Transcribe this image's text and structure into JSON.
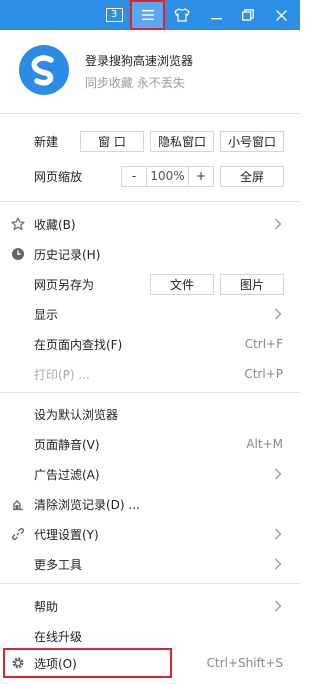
{
  "titlebar": {
    "tab_count": "3",
    "bg_color": "#2d8ee6",
    "icons": [
      "tab-count-icon",
      "menu-icon",
      "skin-icon",
      "minimize-icon",
      "restore-icon",
      "close-icon"
    ]
  },
  "profile": {
    "login_text": "登录搜狗高速浏览器",
    "sync_text": "同步收藏 永不丢失"
  },
  "new_row": {
    "label": "新建",
    "window_btn": "窗 口",
    "private_btn": "隐私窗口",
    "small_btn": "小号窗口"
  },
  "zoom_row": {
    "label": "网页缩放",
    "minus": "-",
    "value": "100%",
    "plus": "+",
    "fullscreen": "全屏"
  },
  "menu": {
    "favorites": "收藏(B)",
    "history": "历史记录(H)",
    "save_as": "网页另存为",
    "save_file": "文件",
    "save_image": "图片",
    "display": "显示",
    "find": "在页面内查找(F)",
    "find_shortcut": "Ctrl+F",
    "print": "打印(P) ...",
    "print_shortcut": "Ctrl+P",
    "set_default": "设为默认浏览器",
    "mute": "页面静音(V)",
    "mute_shortcut": "Alt+M",
    "ad_filter": "广告过滤(A)",
    "clear_history": "清除浏览记录(D) ...",
    "proxy": "代理设置(Y)",
    "more_tools": "更多工具",
    "help": "帮助",
    "upgrade": "在线升级",
    "options": "选项(O)",
    "options_shortcut": "Ctrl+Shift+S"
  }
}
